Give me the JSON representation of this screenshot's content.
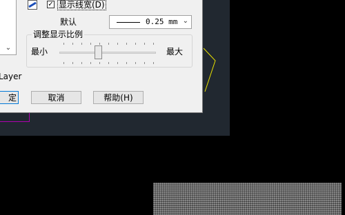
{
  "checkbox": {
    "checked_mark": "✓",
    "label": "显示线宽(D)"
  },
  "default_label": "默认",
  "lineweight_select": {
    "value": "0.25 mm",
    "arrow": "⌄"
  },
  "scale_group": {
    "title": "调整显示比例",
    "min_label": "最小",
    "max_label": "最大",
    "slider_level": 0.4
  },
  "list_scroll_arrow": "⌄",
  "layer_label": "Layer",
  "buttons": {
    "ok": "定",
    "cancel": "取消",
    "help": "帮助(H)"
  },
  "colors": {
    "canvas": "#212830",
    "dialog": "#f0f0f0",
    "polyline": "#e8e000",
    "magenta": "#b000b0",
    "focus": "#0078d7"
  },
  "icons": [
    "lineweight-icon",
    "checkbox-check-icon",
    "dropdown-arrow-icon",
    "scroll-down-icon"
  ]
}
